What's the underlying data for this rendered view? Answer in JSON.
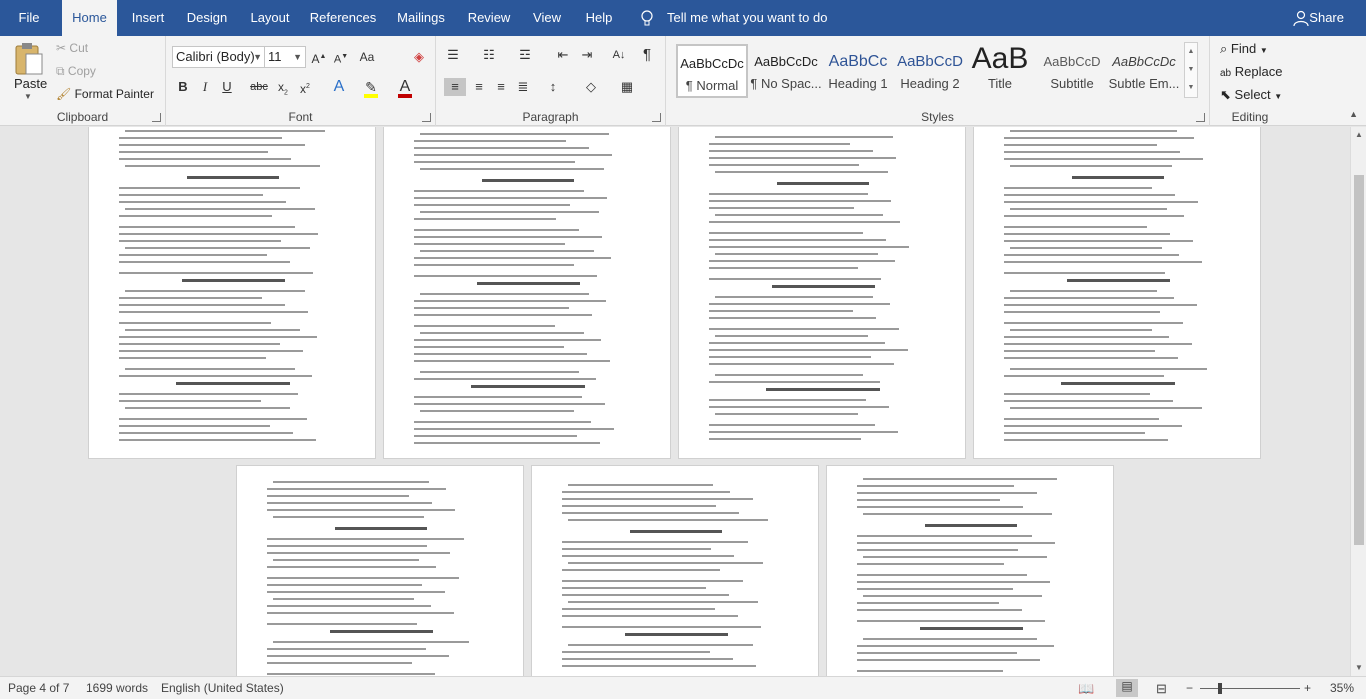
{
  "menu": {
    "file": "File",
    "home": "Home",
    "insert": "Insert",
    "design": "Design",
    "layout": "Layout",
    "references": "References",
    "mailings": "Mailings",
    "review": "Review",
    "view": "View",
    "help": "Help",
    "tell_me": "Tell me what you want to do",
    "share": "Share"
  },
  "clipboard": {
    "label": "Clipboard",
    "paste": "Paste",
    "cut": "Cut",
    "copy": "Copy",
    "format_painter": "Format Painter"
  },
  "font": {
    "label": "Font",
    "name": "Calibri (Body)",
    "size": "11"
  },
  "paragraph": {
    "label": "Paragraph"
  },
  "styles": {
    "label": "Styles",
    "items": [
      {
        "preview": "AaBbCcDc",
        "name": "¶ Normal"
      },
      {
        "preview": "AaBbCcDc",
        "name": "¶ No Spac..."
      },
      {
        "preview": "AaBbCc",
        "name": "Heading 1"
      },
      {
        "preview": "AaBbCcD",
        "name": "Heading 2"
      },
      {
        "preview": "AaB",
        "name": "Title"
      },
      {
        "preview": "AaBbCcD",
        "name": "Subtitle"
      },
      {
        "preview": "AaBbCcDc",
        "name": "Subtle Em..."
      }
    ]
  },
  "editing": {
    "label": "Editing",
    "find": "Find",
    "replace": "Replace",
    "select": "Select"
  },
  "colors": {
    "accent": "#2b579a",
    "highlight": "#ffff00",
    "font_color": "#c00000"
  },
  "status": {
    "page": "Page 4 of 7",
    "words": "1699 words",
    "language": "English (United States)",
    "zoom": "35%"
  }
}
